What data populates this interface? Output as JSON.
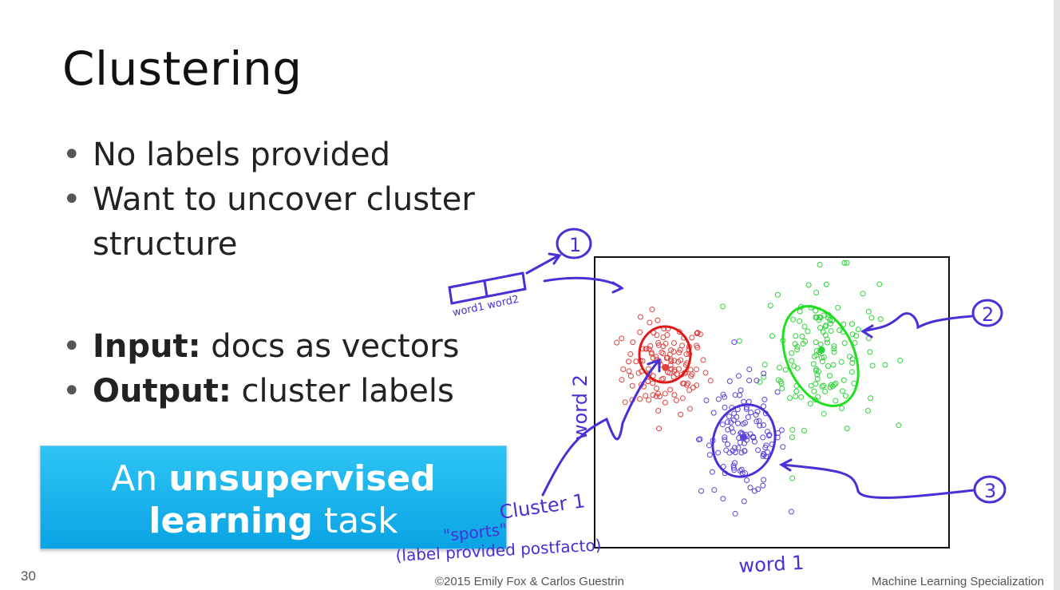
{
  "slide": {
    "title": "Clustering",
    "bullets": [
      {
        "text": "No labels provided"
      },
      {
        "text": "Want to uncover cluster structure"
      },
      {
        "bold": "Input:",
        "text": " docs as vectors"
      },
      {
        "bold": "Output:",
        "text": " cluster labels"
      }
    ],
    "callout": {
      "pre": "An ",
      "bold1": "unsupervised",
      "bold2": "learning",
      "post": " task"
    }
  },
  "annotations": {
    "vector_labels": "word1  word2",
    "circle_1": "1",
    "circle_2": "2",
    "circle_3": "3",
    "axis_x": "word 1",
    "axis_y": "word 2",
    "cluster_note": "Cluster 1",
    "sports_note": "\"sports\"",
    "label_note": "(label provided postfacto)"
  },
  "chart_data": {
    "type": "scatter",
    "xlabel": "word 1",
    "ylabel": "word 2",
    "series": [
      {
        "color": "#e0433f",
        "center": [
          0.2,
          0.62
        ],
        "spread": [
          0.06,
          0.08
        ],
        "count": 130
      },
      {
        "color": "#30d23a",
        "center": [
          0.64,
          0.68
        ],
        "spread": [
          0.08,
          0.13
        ],
        "count": 140
      },
      {
        "color": "#5a45d8",
        "center": [
          0.42,
          0.38
        ],
        "spread": [
          0.06,
          0.1
        ],
        "count": 120
      }
    ],
    "centers": [
      {
        "color": "#e0433f",
        "value": [
          0.2,
          0.62
        ]
      },
      {
        "color": "#30d23a",
        "value": [
          0.64,
          0.68
        ]
      },
      {
        "color": "#5a45d8",
        "value": [
          0.42,
          0.38
        ]
      }
    ]
  },
  "footer": {
    "page_number": "30",
    "copyright": "©2015 Emily Fox & Carlos Guestrin",
    "course": "Machine Learning Specialization"
  }
}
